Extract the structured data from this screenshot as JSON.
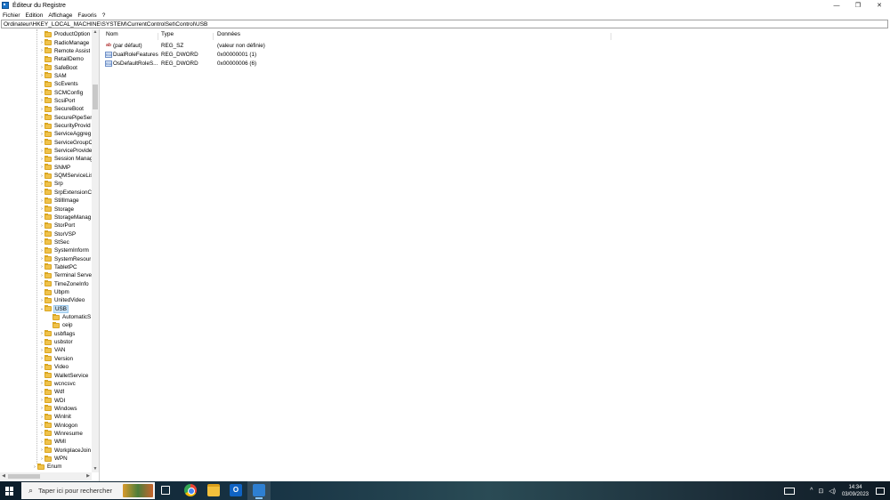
{
  "window": {
    "title": "Éditeur du Registre",
    "controls": {
      "minimize": "—",
      "maximize": "❐",
      "close": "✕"
    }
  },
  "menu": [
    "Fichier",
    "Edition",
    "Affichage",
    "Favoris",
    "?"
  ],
  "address": "Ordinateur\\HKEY_LOCAL_MACHINE\\SYSTEM\\CurrentControlSet\\Control\\USB",
  "tree": {
    "items": [
      {
        "label": "ProductOption",
        "level": 1,
        "expander": ""
      },
      {
        "label": "RadioManage",
        "level": 1,
        "expander": ">"
      },
      {
        "label": "Remote Assist",
        "level": 1,
        "expander": ">"
      },
      {
        "label": "RetailDemo",
        "level": 1,
        "expander": ""
      },
      {
        "label": "SafeBoot",
        "level": 1,
        "expander": ">"
      },
      {
        "label": "SAM",
        "level": 1,
        "expander": ">"
      },
      {
        "label": "ScEvents",
        "level": 1,
        "expander": ""
      },
      {
        "label": "SCMConfig",
        "level": 1,
        "expander": ">"
      },
      {
        "label": "ScsiPort",
        "level": 1,
        "expander": ">"
      },
      {
        "label": "SecureBoot",
        "level": 1,
        "expander": ">"
      },
      {
        "label": "SecurePipeSer",
        "level": 1,
        "expander": ">"
      },
      {
        "label": "SecurityProvid",
        "level": 1,
        "expander": ">"
      },
      {
        "label": "ServiceAggreg",
        "level": 1,
        "expander": ">"
      },
      {
        "label": "ServiceGroupC",
        "level": 1,
        "expander": ">"
      },
      {
        "label": "ServiceProvide",
        "level": 1,
        "expander": ">"
      },
      {
        "label": "Session Manag",
        "level": 1,
        "expander": ">"
      },
      {
        "label": "SNMP",
        "level": 1,
        "expander": ">"
      },
      {
        "label": "SQMServiceLis",
        "level": 1,
        "expander": ">"
      },
      {
        "label": "Srp",
        "level": 1,
        "expander": ">"
      },
      {
        "label": "SrpExtensionC",
        "level": 1,
        "expander": ">"
      },
      {
        "label": "StillImage",
        "level": 1,
        "expander": ">"
      },
      {
        "label": "Storage",
        "level": 1,
        "expander": ">"
      },
      {
        "label": "StorageManag",
        "level": 1,
        "expander": ">"
      },
      {
        "label": "StorPort",
        "level": 1,
        "expander": ">"
      },
      {
        "label": "StorVSP",
        "level": 1,
        "expander": ">"
      },
      {
        "label": "StSec",
        "level": 1,
        "expander": ">"
      },
      {
        "label": "SystemInform",
        "level": 1,
        "expander": ">"
      },
      {
        "label": "SystemResour",
        "level": 1,
        "expander": ">"
      },
      {
        "label": "TabletPC",
        "level": 1,
        "expander": ">"
      },
      {
        "label": "Terminal Serve",
        "level": 1,
        "expander": ">"
      },
      {
        "label": "TimeZoneInfo",
        "level": 1,
        "expander": ">"
      },
      {
        "label": "Ubpm",
        "level": 1,
        "expander": ""
      },
      {
        "label": "UnitedVideo",
        "level": 1,
        "expander": ">"
      },
      {
        "label": "USB",
        "level": 1,
        "expander": "v",
        "selected": true
      },
      {
        "label": "AutomaticS",
        "level": 2,
        "expander": ""
      },
      {
        "label": "ceip",
        "level": 2,
        "expander": ""
      },
      {
        "label": "usbflags",
        "level": 1,
        "expander": ">"
      },
      {
        "label": "usbstor",
        "level": 1,
        "expander": ">"
      },
      {
        "label": "VAN",
        "level": 1,
        "expander": ">"
      },
      {
        "label": "Version",
        "level": 1,
        "expander": ">"
      },
      {
        "label": "Video",
        "level": 1,
        "expander": ">"
      },
      {
        "label": "WalletService",
        "level": 1,
        "expander": ""
      },
      {
        "label": "wcncsvc",
        "level": 1,
        "expander": ">"
      },
      {
        "label": "Wdf",
        "level": 1,
        "expander": ">"
      },
      {
        "label": "WDI",
        "level": 1,
        "expander": ">"
      },
      {
        "label": "Windows",
        "level": 1,
        "expander": ">"
      },
      {
        "label": "Winlnit",
        "level": 1,
        "expander": ">"
      },
      {
        "label": "Winlogon",
        "level": 1,
        "expander": ">"
      },
      {
        "label": "Winresume",
        "level": 1,
        "expander": ">"
      },
      {
        "label": "WMI",
        "level": 1,
        "expander": ">"
      },
      {
        "label": "WorkplaceJoin",
        "level": 1,
        "expander": ">"
      },
      {
        "label": "WPN",
        "level": 1,
        "expander": ">"
      },
      {
        "label": "Enum",
        "level": 0,
        "expander": ">"
      }
    ]
  },
  "list": {
    "columns": [
      "Nom",
      "Type",
      "Données"
    ],
    "rows": [
      {
        "icon": "string-value-icon",
        "kind": "sz",
        "name": "(par défaut)",
        "type": "REG_SZ",
        "data": "(valeur non définie)"
      },
      {
        "icon": "dword-value-icon",
        "kind": "dw",
        "name": "DualRoleFeatures",
        "type": "REG_DWORD",
        "data": "0x00000001 (1)"
      },
      {
        "icon": "dword-value-icon",
        "kind": "dw",
        "name": "OsDefaultRoleS...",
        "type": "REG_DWORD",
        "data": "0x00000006 (6)"
      }
    ]
  },
  "taskbar": {
    "search_placeholder": "Taper ici pour rechercher",
    "apps": [
      "task-view-icon",
      "chrome-icon",
      "file-explorer-icon",
      "outlook-icon",
      "regedit-icon"
    ],
    "outlook_letter": "O",
    "clock_time": "14:34",
    "clock_date": "03/09/2023"
  }
}
